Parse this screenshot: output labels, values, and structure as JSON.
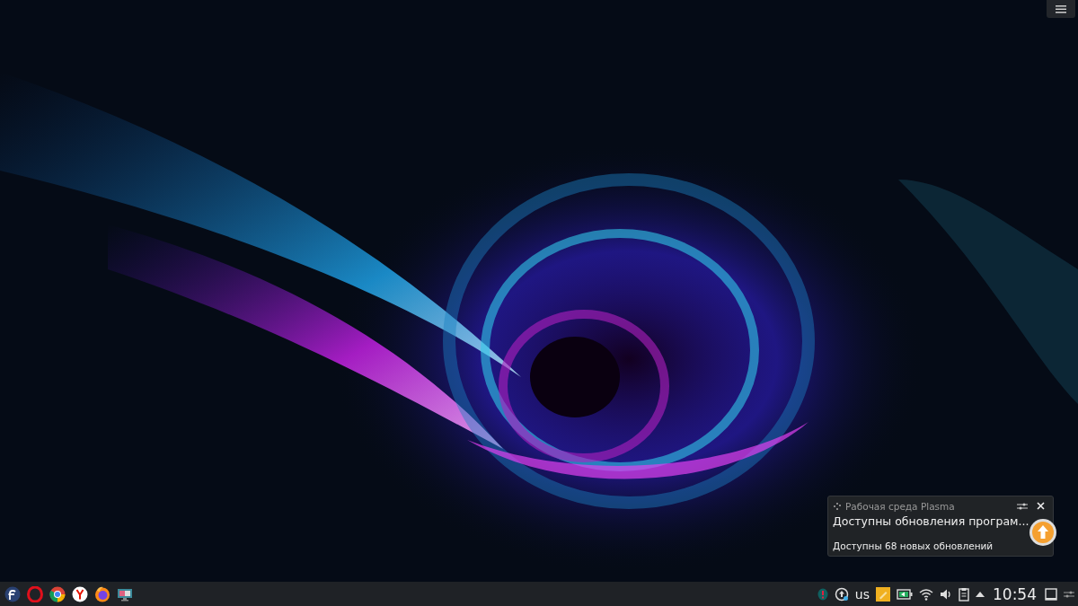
{
  "notification": {
    "app_name": "Рабочая среда Plasma",
    "title": "Доступны обновления програм...",
    "body": "Доступны 68 новых обновлений"
  },
  "tray": {
    "keyboard_layout": "us",
    "clock": "10:54"
  }
}
